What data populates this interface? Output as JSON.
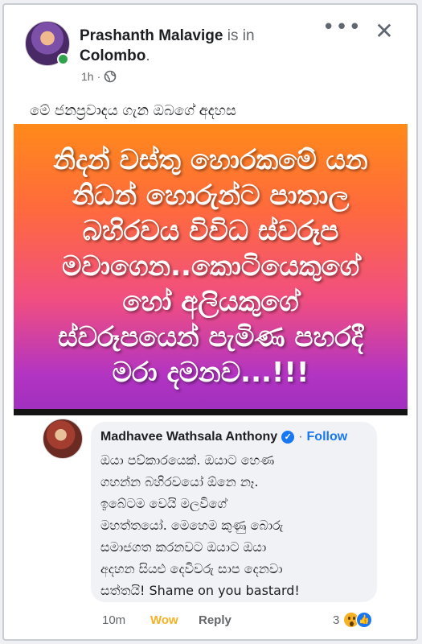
{
  "post": {
    "author": "Prashanth Malavige",
    "location_prefix": "is in",
    "location": "Colombo",
    "location_suffix": ".",
    "time": "1h",
    "time_separator": "·",
    "audience_icon": "globe-icon",
    "menu_icon": "•••",
    "close_icon": "✕",
    "caption": "මේ ජනප්‍රවාදය ගැන ඔබගේ අදහස",
    "image_text": "නිදන් වස්තු හොරකමේ යන\nනිධන් හොරුන්ට පාතාල\nබහිරවය විවිධ ස්වරූප\nමවාගෙන..කොටියෙකුගේ\nහෝ අලියකුගේ\nස්වරූපයෙන් පැමිණ පහරදී\nමරා දමනව...!!!",
    "image_colors": {
      "top": "#ff8a1a",
      "middle": "#f04e82",
      "bottom": "#a12fbf"
    }
  },
  "comment": {
    "name": "Madhavee Wathsala Anthony",
    "verified_icon": "✓",
    "separator": "·",
    "follow_label": "Follow",
    "text": "ඔයා පව්කාරයෙක්. ඔයාට හෙණ\nගහන්න බහිරවයෝ ඕනෙ නෑ.\nඉබේටම වෙයි මලවිගේ\nමහත්තයෝ. මෙහෙම කුණු බොරු\nසමාජගත කරනවට ඔයාට ඔයා\nඅදහන සියළු දෙවිවරු සාප දෙනවා\nසත්තයි! Shame on you bastard!",
    "time": "10m",
    "reaction_label": "Wow",
    "reply_label": "Reply",
    "reaction_count": "3",
    "reaction_icons": [
      "wow-icon",
      "like-icon"
    ]
  },
  "colors": {
    "accent": "#1877f2",
    "wow": "#f7b125",
    "online": "#31a24c"
  }
}
